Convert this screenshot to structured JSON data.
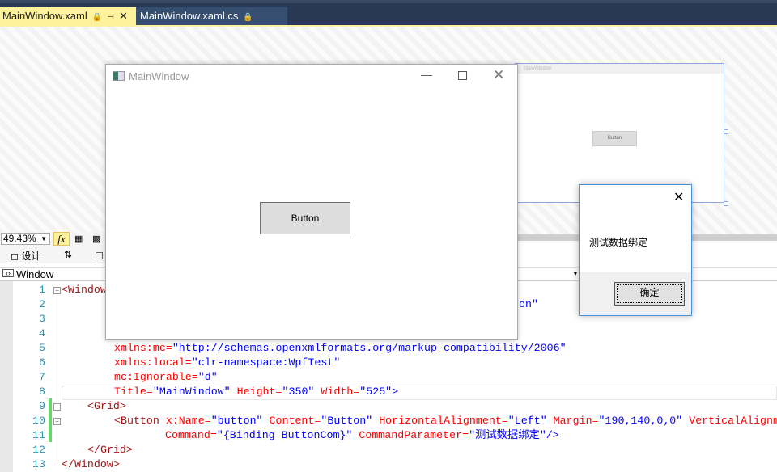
{
  "tabs": [
    {
      "label": "MainWindow.xaml",
      "active": true
    },
    {
      "label": "MainWindow.xaml.cs",
      "active": false
    }
  ],
  "toolbar": {
    "zoom": "49.43%",
    "fx_label": "fx",
    "design_label": "设计"
  },
  "nav": {
    "element": "Window"
  },
  "designer": {
    "window_title": "MainWindow",
    "button_label": "Button",
    "preview_title": "MainWindow",
    "preview_button": "Button"
  },
  "dialog": {
    "message": "测试数据绑定",
    "ok_label": "确定"
  },
  "colors": {
    "tab_active": "#fff29d",
    "tab_bar": "#293955",
    "tag": "#a31515",
    "attr": "#ff0000",
    "value": "#0000ff",
    "line_number": "#2b91af"
  },
  "code": {
    "line_numbers": [
      "1",
      "2",
      "3",
      "4",
      "5",
      "6",
      "7",
      "8",
      "9",
      "10",
      "11",
      "12",
      "13"
    ],
    "l1": "<Window",
    "l2_tail": "on\"",
    "l5a": "xmlns:mc=",
    "l5b": "\"http://schemas.openxmlformats.org/markup-compatibility/2006\"",
    "l6a": "xmlns:local=",
    "l6b": "\"clr-namespace:WpfTest\"",
    "l7a": "mc:Ignorable=",
    "l7b": "\"d\"",
    "l8a": "Title=",
    "l8b": "\"MainWindow\"",
    "l8c": " Height=",
    "l8d": "\"350\"",
    "l8e": " Width=",
    "l8f": "\"525\"",
    "l8g": ">",
    "l9": "<Grid>",
    "l10a": "<Button",
    " l10b": "",
    "l10c": " x:Name=",
    "l10d": "\"button\"",
    "l10e": " Content=",
    "l10f": "\"Button\"",
    "l10g": " HorizontalAlignment=",
    "l10h": "\"Left\"",
    "l10i": " Margin=",
    "l10j": "\"190,140,0,0\"",
    "l10k": " VerticalAlignm",
    "l11a": "Command=",
    "l11b": "\"{Binding ButtonCom}\"",
    "l11c": " CommandParameter=",
    "l11d": "\"测试数据绑定\"",
    "l11e": "/>",
    "l12": "</Grid>",
    "l13": "</Window>"
  }
}
